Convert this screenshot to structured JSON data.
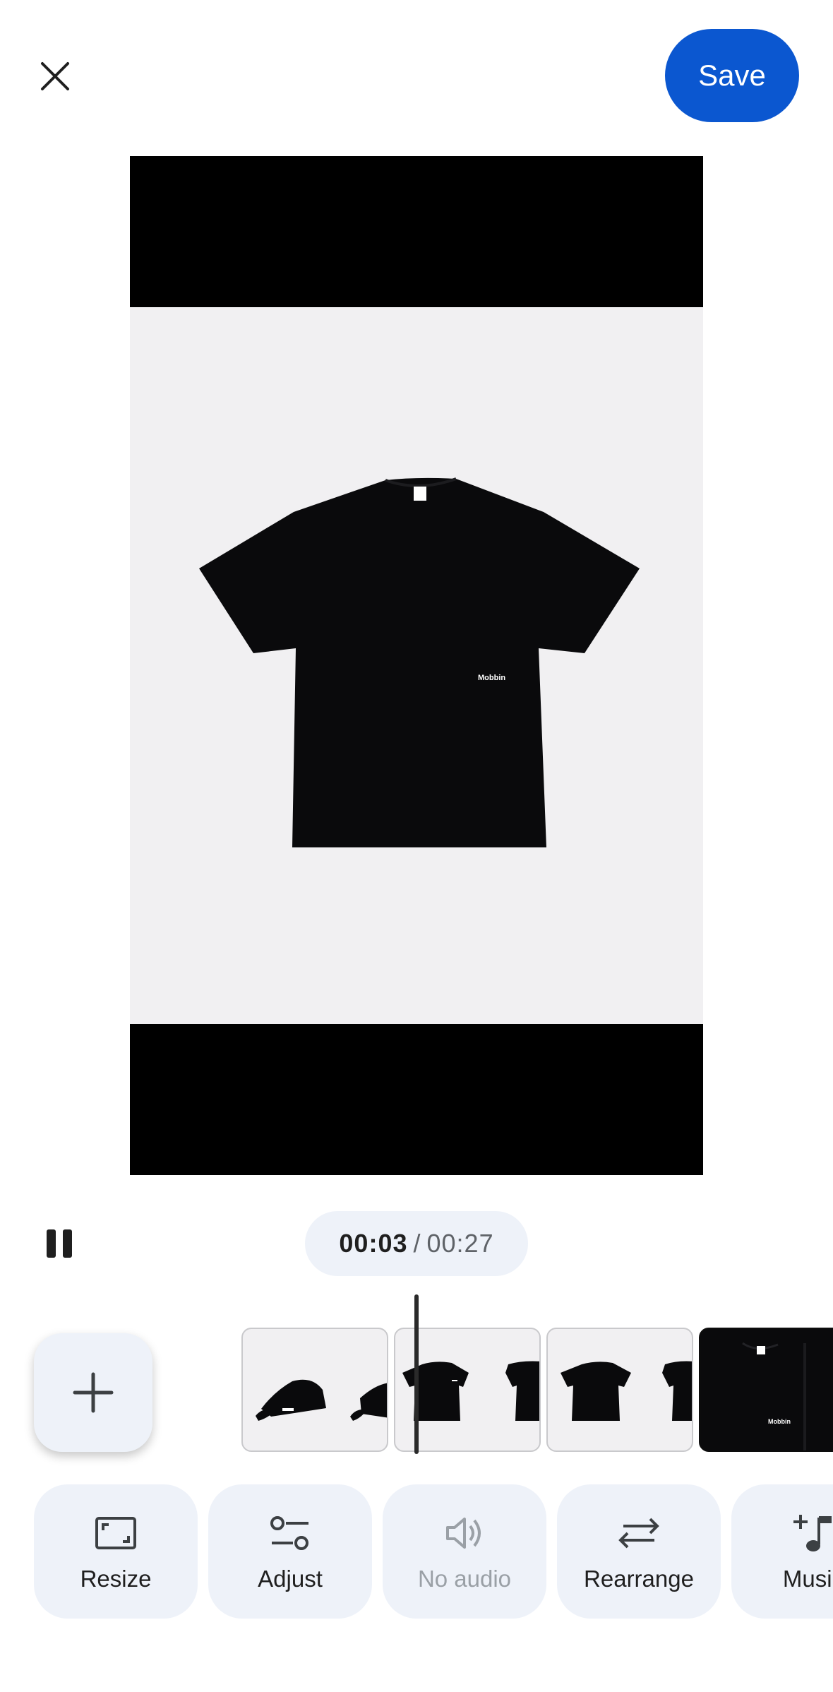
{
  "header": {
    "close_icon": "close-icon",
    "save_label": "Save"
  },
  "preview": {
    "brand_text": "Mobbin"
  },
  "playback": {
    "pause_icon": "pause-icon",
    "current_time": "00:03",
    "separator": "/",
    "total_time": "00:27"
  },
  "timeline": {
    "add_icon": "plus-icon",
    "clips": [
      {
        "name": "cap",
        "kind": "cap-thumbnail"
      },
      {
        "name": "tshirt-1",
        "kind": "tshirt-thumbnail"
      },
      {
        "name": "tshirt-2",
        "kind": "tshirt-thumbnail"
      },
      {
        "name": "tshirt-closeup",
        "kind": "tshirt-closeup-thumbnail"
      }
    ],
    "closeup_brand": "Mobbin"
  },
  "tools": [
    {
      "label": "Resize",
      "icon": "resize-icon",
      "enabled": true
    },
    {
      "label": "Adjust",
      "icon": "adjust-icon",
      "enabled": true
    },
    {
      "label": "No audio",
      "icon": "volume-icon",
      "enabled": false
    },
    {
      "label": "Rearrange",
      "icon": "swap-icon",
      "enabled": true
    },
    {
      "label": "Music",
      "icon": "music-add-icon",
      "enabled": true
    }
  ],
  "colors": {
    "accent": "#0b57d0",
    "chip_bg": "#eef2f9",
    "preview_bg": "#f1f0f2"
  }
}
